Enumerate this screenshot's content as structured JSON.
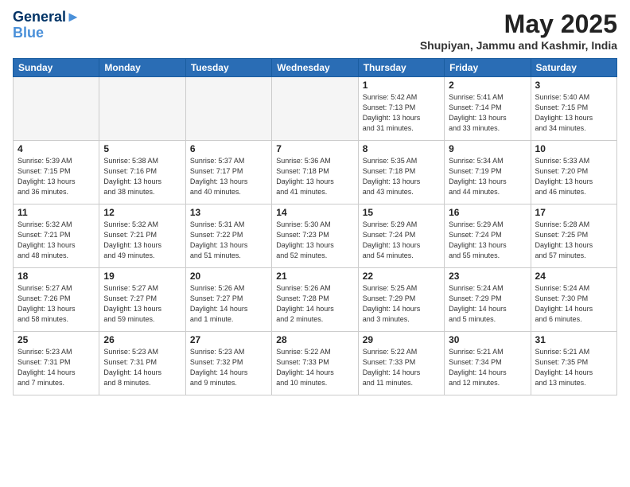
{
  "header": {
    "logo_line1": "General",
    "logo_line2": "Blue",
    "month_title": "May 2025",
    "location": "Shupiyan, Jammu and Kashmir, India"
  },
  "weekdays": [
    "Sunday",
    "Monday",
    "Tuesday",
    "Wednesday",
    "Thursday",
    "Friday",
    "Saturday"
  ],
  "weeks": [
    [
      {
        "day": "",
        "info": ""
      },
      {
        "day": "",
        "info": ""
      },
      {
        "day": "",
        "info": ""
      },
      {
        "day": "",
        "info": ""
      },
      {
        "day": "1",
        "info": "Sunrise: 5:42 AM\nSunset: 7:13 PM\nDaylight: 13 hours\nand 31 minutes."
      },
      {
        "day": "2",
        "info": "Sunrise: 5:41 AM\nSunset: 7:14 PM\nDaylight: 13 hours\nand 33 minutes."
      },
      {
        "day": "3",
        "info": "Sunrise: 5:40 AM\nSunset: 7:15 PM\nDaylight: 13 hours\nand 34 minutes."
      }
    ],
    [
      {
        "day": "4",
        "info": "Sunrise: 5:39 AM\nSunset: 7:15 PM\nDaylight: 13 hours\nand 36 minutes."
      },
      {
        "day": "5",
        "info": "Sunrise: 5:38 AM\nSunset: 7:16 PM\nDaylight: 13 hours\nand 38 minutes."
      },
      {
        "day": "6",
        "info": "Sunrise: 5:37 AM\nSunset: 7:17 PM\nDaylight: 13 hours\nand 40 minutes."
      },
      {
        "day": "7",
        "info": "Sunrise: 5:36 AM\nSunset: 7:18 PM\nDaylight: 13 hours\nand 41 minutes."
      },
      {
        "day": "8",
        "info": "Sunrise: 5:35 AM\nSunset: 7:18 PM\nDaylight: 13 hours\nand 43 minutes."
      },
      {
        "day": "9",
        "info": "Sunrise: 5:34 AM\nSunset: 7:19 PM\nDaylight: 13 hours\nand 44 minutes."
      },
      {
        "day": "10",
        "info": "Sunrise: 5:33 AM\nSunset: 7:20 PM\nDaylight: 13 hours\nand 46 minutes."
      }
    ],
    [
      {
        "day": "11",
        "info": "Sunrise: 5:32 AM\nSunset: 7:21 PM\nDaylight: 13 hours\nand 48 minutes."
      },
      {
        "day": "12",
        "info": "Sunrise: 5:32 AM\nSunset: 7:21 PM\nDaylight: 13 hours\nand 49 minutes."
      },
      {
        "day": "13",
        "info": "Sunrise: 5:31 AM\nSunset: 7:22 PM\nDaylight: 13 hours\nand 51 minutes."
      },
      {
        "day": "14",
        "info": "Sunrise: 5:30 AM\nSunset: 7:23 PM\nDaylight: 13 hours\nand 52 minutes."
      },
      {
        "day": "15",
        "info": "Sunrise: 5:29 AM\nSunset: 7:24 PM\nDaylight: 13 hours\nand 54 minutes."
      },
      {
        "day": "16",
        "info": "Sunrise: 5:29 AM\nSunset: 7:24 PM\nDaylight: 13 hours\nand 55 minutes."
      },
      {
        "day": "17",
        "info": "Sunrise: 5:28 AM\nSunset: 7:25 PM\nDaylight: 13 hours\nand 57 minutes."
      }
    ],
    [
      {
        "day": "18",
        "info": "Sunrise: 5:27 AM\nSunset: 7:26 PM\nDaylight: 13 hours\nand 58 minutes."
      },
      {
        "day": "19",
        "info": "Sunrise: 5:27 AM\nSunset: 7:27 PM\nDaylight: 13 hours\nand 59 minutes."
      },
      {
        "day": "20",
        "info": "Sunrise: 5:26 AM\nSunset: 7:27 PM\nDaylight: 14 hours\nand 1 minute."
      },
      {
        "day": "21",
        "info": "Sunrise: 5:26 AM\nSunset: 7:28 PM\nDaylight: 14 hours\nand 2 minutes."
      },
      {
        "day": "22",
        "info": "Sunrise: 5:25 AM\nSunset: 7:29 PM\nDaylight: 14 hours\nand 3 minutes."
      },
      {
        "day": "23",
        "info": "Sunrise: 5:24 AM\nSunset: 7:29 PM\nDaylight: 14 hours\nand 5 minutes."
      },
      {
        "day": "24",
        "info": "Sunrise: 5:24 AM\nSunset: 7:30 PM\nDaylight: 14 hours\nand 6 minutes."
      }
    ],
    [
      {
        "day": "25",
        "info": "Sunrise: 5:23 AM\nSunset: 7:31 PM\nDaylight: 14 hours\nand 7 minutes."
      },
      {
        "day": "26",
        "info": "Sunrise: 5:23 AM\nSunset: 7:31 PM\nDaylight: 14 hours\nand 8 minutes."
      },
      {
        "day": "27",
        "info": "Sunrise: 5:23 AM\nSunset: 7:32 PM\nDaylight: 14 hours\nand 9 minutes."
      },
      {
        "day": "28",
        "info": "Sunrise: 5:22 AM\nSunset: 7:33 PM\nDaylight: 14 hours\nand 10 minutes."
      },
      {
        "day": "29",
        "info": "Sunrise: 5:22 AM\nSunset: 7:33 PM\nDaylight: 14 hours\nand 11 minutes."
      },
      {
        "day": "30",
        "info": "Sunrise: 5:21 AM\nSunset: 7:34 PM\nDaylight: 14 hours\nand 12 minutes."
      },
      {
        "day": "31",
        "info": "Sunrise: 5:21 AM\nSunset: 7:35 PM\nDaylight: 14 hours\nand 13 minutes."
      }
    ]
  ]
}
